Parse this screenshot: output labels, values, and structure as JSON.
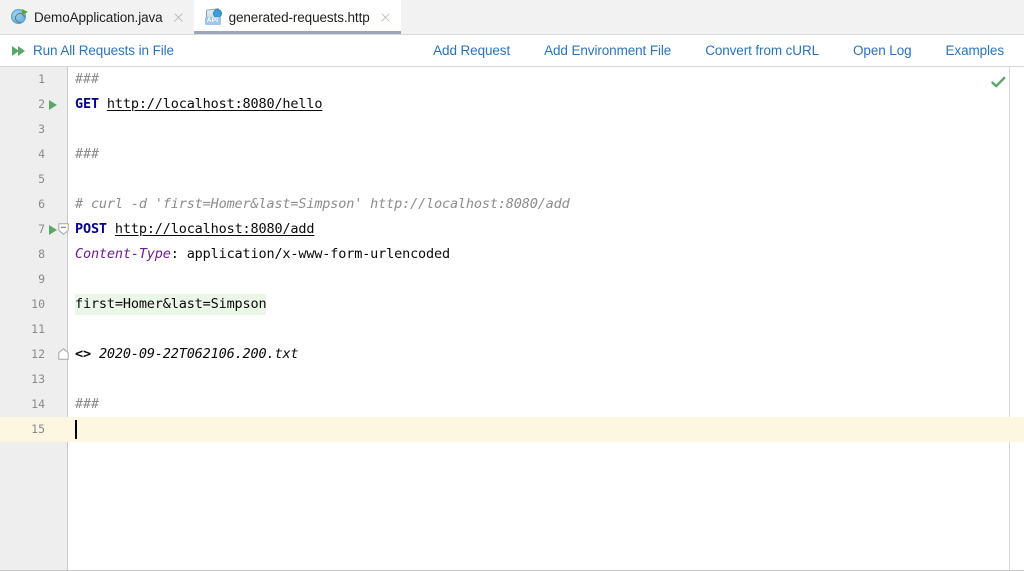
{
  "tabs": [
    {
      "label": "DemoApplication.java",
      "icon": "spring-boot-icon",
      "active": false,
      "close_icon": "close-icon"
    },
    {
      "label": "generated-requests.http",
      "icon": "api-file-icon",
      "active": true,
      "close_icon": "close-icon"
    }
  ],
  "toolbar": {
    "run_all_label": "Run All Requests in File",
    "run_all_icon": "run-all-icon",
    "links": [
      {
        "label": "Add Request"
      },
      {
        "label": "Add Environment File"
      },
      {
        "label": "Convert from cURL"
      },
      {
        "label": "Open Log"
      },
      {
        "label": "Examples"
      }
    ]
  },
  "editor": {
    "inspection_status_icon": "green-checkmark-icon",
    "caret_line": 15,
    "lines": [
      {
        "n": "1",
        "segments": [
          {
            "text": "###",
            "style": "comment"
          }
        ]
      },
      {
        "n": "2",
        "run": true,
        "segments": [
          {
            "text": "GET",
            "style": "method"
          },
          {
            "text": " ",
            "style": "plain"
          },
          {
            "text": "http://localhost:8080/hello",
            "style": "url"
          }
        ]
      },
      {
        "n": "3",
        "segments": []
      },
      {
        "n": "4",
        "segments": [
          {
            "text": "###",
            "style": "comment"
          }
        ]
      },
      {
        "n": "5",
        "segments": []
      },
      {
        "n": "6",
        "segments": [
          {
            "text": "# curl -d 'first=Homer&last=Simpson' http://localhost:8080/add",
            "style": "comment"
          }
        ]
      },
      {
        "n": "7",
        "run": true,
        "fold": "start",
        "segments": [
          {
            "text": "POST",
            "style": "method"
          },
          {
            "text": " ",
            "style": "plain"
          },
          {
            "text": "http://localhost:8080/add",
            "style": "url"
          }
        ]
      },
      {
        "n": "8",
        "segments": [
          {
            "text": "Content-Type",
            "style": "header-name"
          },
          {
            "text": ": application/x-www-form-urlencoded",
            "style": "plain"
          }
        ]
      },
      {
        "n": "9",
        "segments": []
      },
      {
        "n": "10",
        "segments": [
          {
            "text": "first=Homer&last=Simpson",
            "style": "bodyhl"
          }
        ]
      },
      {
        "n": "11",
        "segments": []
      },
      {
        "n": "12",
        "fold": "end",
        "segments": [
          {
            "text": "<>",
            "style": "angle"
          },
          {
            "text": " ",
            "style": "plain"
          },
          {
            "text": "2020-09-22T062106.200.txt",
            "style": "fileref"
          }
        ]
      },
      {
        "n": "13",
        "segments": []
      },
      {
        "n": "14",
        "segments": [
          {
            "text": "###",
            "style": "comment"
          }
        ]
      },
      {
        "n": "15",
        "caret": true,
        "segments": []
      }
    ]
  },
  "colors": {
    "link": "#2b74b7",
    "method_keyword": "#00008b",
    "comment": "#8c8c8c",
    "header_name": "#6f1d8f",
    "run_green": "#59a869",
    "body_highlight": "#eaf6e6",
    "caret_line": "#fdf7e2",
    "gutter": "#eeeeee",
    "tab_underline": "#9aa7bb"
  }
}
